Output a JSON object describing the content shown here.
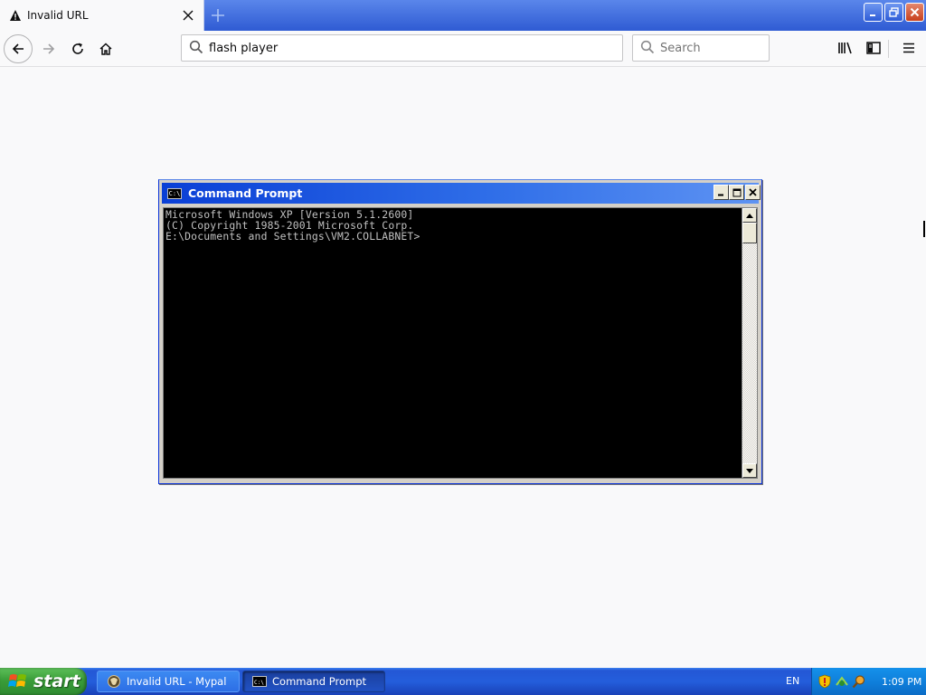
{
  "browser": {
    "tab": {
      "title": "Invalid URL",
      "icon": "warning-icon"
    },
    "new_tab_icon": "plus-icon",
    "window_controls": [
      "minimize-icon",
      "restore-icon",
      "close-icon"
    ],
    "nav": {
      "back_icon": "back-arrow-icon",
      "forward_icon": "forward-arrow-icon",
      "reload_icon": "reload-icon",
      "home_icon": "home-icon"
    },
    "url_value": "flash player",
    "search_placeholder": "Search",
    "toolbar_icons": [
      "library-icon",
      "sidebar-icon",
      "hamburger-menu-icon"
    ]
  },
  "cmd": {
    "title": "Command Prompt",
    "lines": [
      "Microsoft Windows XP [Version 5.1.2600]",
      "(C) Copyright 1985-2001 Microsoft Corp.",
      "",
      "E:\\Documents and Settings\\VM2.COLLABNET>"
    ]
  },
  "taskbar": {
    "start_label": "start",
    "tasks": [
      {
        "label": "Invalid URL - Mypal"
      },
      {
        "label": "Command Prompt"
      }
    ],
    "language": "EN",
    "clock": "1:09 PM"
  },
  "colors": {
    "xp_blue": "#245edc",
    "start_green": "#3a9d39",
    "console_text": "#c0c0c0",
    "console_bg": "#000000"
  }
}
